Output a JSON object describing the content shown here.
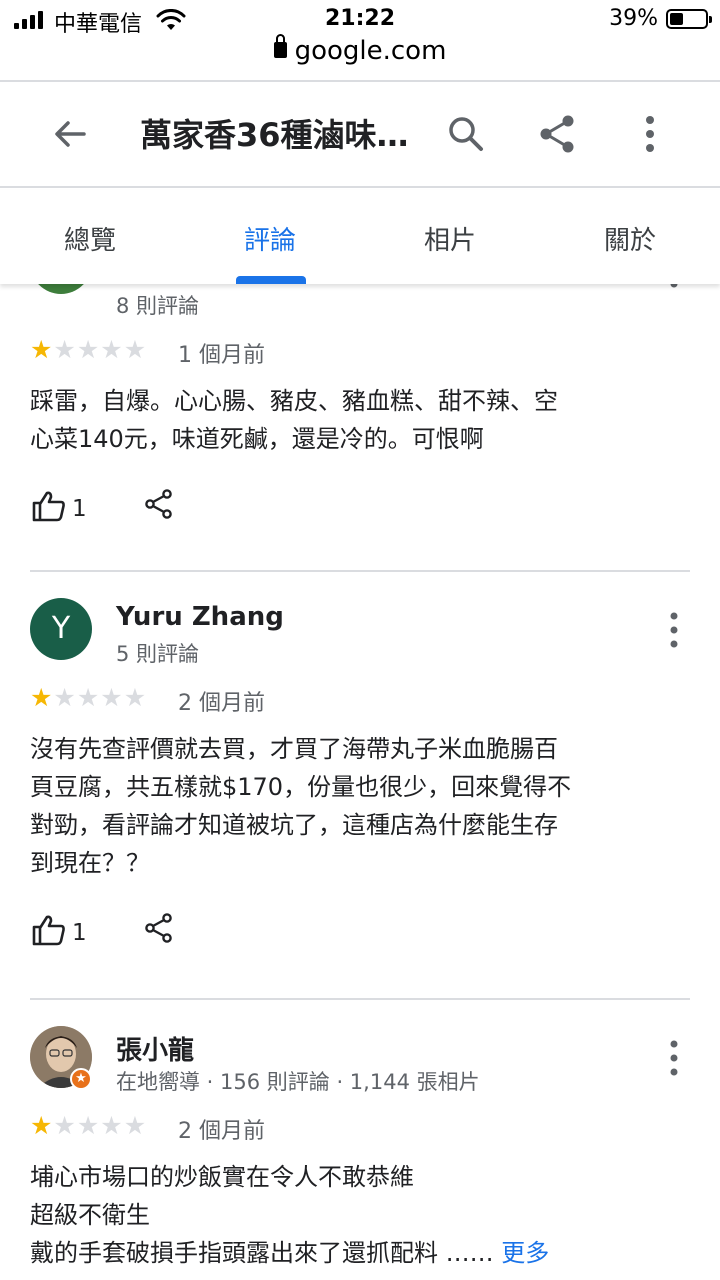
{
  "status_bar": {
    "carrier": "中華電信",
    "time": "21:22",
    "battery": "39%",
    "battery_level": 0.39
  },
  "browser": {
    "url": "google.com"
  },
  "header": {
    "title": "萬家香36種滷味…"
  },
  "tabs": [
    {
      "label": "總覽",
      "active": false
    },
    {
      "label": "評論",
      "active": true
    },
    {
      "label": "相片",
      "active": false
    },
    {
      "label": "關於",
      "active": false
    }
  ],
  "reviews": [
    {
      "meta": "8 則評論",
      "rating": 1,
      "time": "1 個月前",
      "text": [
        "踩雷，自爆。心心腸、豬皮、豬血糕、甜不辣、空",
        "心菜140元，味道死鹹，還是冷的。可恨啊"
      ],
      "likes": "1"
    },
    {
      "avatar_letter": "Y",
      "author": "Yuru Zhang",
      "meta": "5 則評論",
      "rating": 1,
      "time": "2 個月前",
      "text": [
        "沒有先查評價就去買，才買了海帶丸子米血脆腸百",
        "頁豆腐，共五樣就$170，份量也很少，回來覺得不",
        "對勁，看評論才知道被坑了，這種店為什麼能生存",
        "到現在？？"
      ],
      "likes": "1"
    },
    {
      "author": "張小龍",
      "meta": "在地嚮導 · 156 則評論 · 1,144 張相片",
      "rating": 1,
      "time": "2 個月前",
      "text": [
        "埔心市場口的炒飯實在令人不敢恭維",
        "超級不衛生",
        "戴的手套破損手指頭露出來了還抓配料 ……"
      ],
      "more": "更多"
    }
  ],
  "colors": {
    "accent": "#1a73e8",
    "star": "#f6b704",
    "star_empty": "#dadce0",
    "avatar_y": "#195e48"
  }
}
